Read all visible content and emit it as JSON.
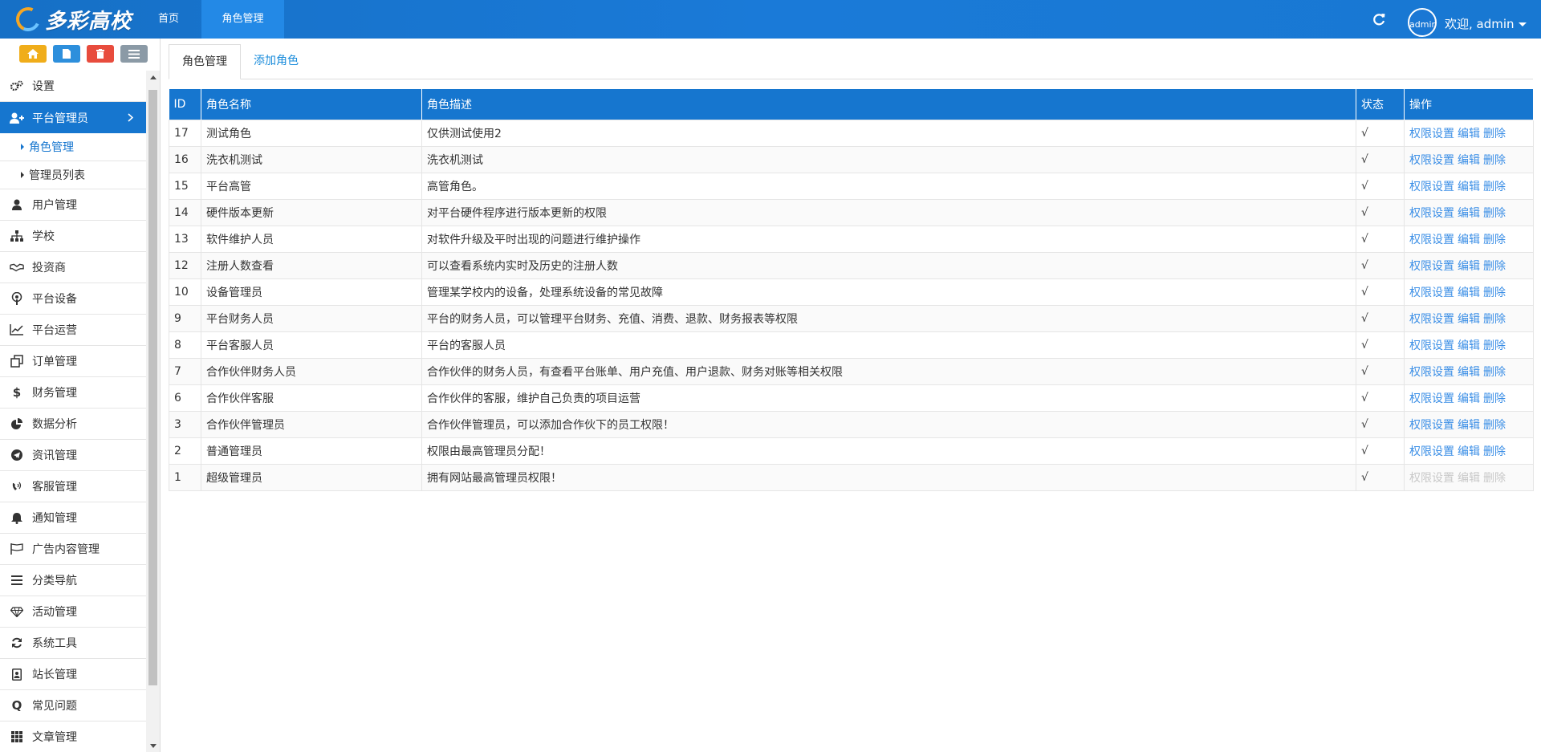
{
  "header": {
    "logo_text": "多彩高校",
    "nav": [
      {
        "label": "首页"
      },
      {
        "label": "角色管理"
      }
    ],
    "avatar_alt": "admin",
    "welcome": "欢迎, admin"
  },
  "sidebar": {
    "items": [
      {
        "label": "设置",
        "icon": "gears-icon"
      },
      {
        "label": "平台管理员",
        "icon": "user-plus-icon"
      },
      {
        "label": "用户管理",
        "icon": "user-icon"
      },
      {
        "label": "学校",
        "icon": "sitemap-icon"
      },
      {
        "label": "投资商",
        "icon": "handshake-icon"
      },
      {
        "label": "平台设备",
        "icon": "podcast-icon"
      },
      {
        "label": "平台运营",
        "icon": "line-chart-icon"
      },
      {
        "label": "订单管理",
        "icon": "clone-icon"
      },
      {
        "label": "财务管理",
        "icon": "dollar-icon"
      },
      {
        "label": "数据分析",
        "icon": "pie-chart-icon"
      },
      {
        "label": "资讯管理",
        "icon": "telegram-icon"
      },
      {
        "label": "客服管理",
        "icon": "volume-control-phone-icon"
      },
      {
        "label": "通知管理",
        "icon": "bell-icon"
      },
      {
        "label": "广告内容管理",
        "icon": "flag-icon"
      },
      {
        "label": "分类导航",
        "icon": "bars-icon"
      },
      {
        "label": "活动管理",
        "icon": "diamond-icon"
      },
      {
        "label": "系统工具",
        "icon": "refresh-icon"
      },
      {
        "label": "站长管理",
        "icon": "id-badge-icon"
      },
      {
        "label": "常见问题",
        "icon": "quora-icon"
      },
      {
        "label": "文章管理",
        "icon": "th-icon"
      }
    ],
    "sub_items": [
      {
        "label": "角色管理"
      },
      {
        "label": "管理员列表"
      }
    ]
  },
  "main": {
    "tabs": [
      {
        "label": "角色管理"
      },
      {
        "label": "添加角色"
      }
    ],
    "table": {
      "headers": [
        "ID",
        "角色名称",
        "角色描述",
        "状态",
        "操作"
      ],
      "rows": [
        {
          "id": "17",
          "name": "测试角色",
          "desc": "仅供测试使用2",
          "status": "√"
        },
        {
          "id": "16",
          "name": "洗衣机测试",
          "desc": "洗衣机测试",
          "status": "√"
        },
        {
          "id": "15",
          "name": "平台高管",
          "desc": "高管角色。",
          "status": "√"
        },
        {
          "id": "14",
          "name": "硬件版本更新",
          "desc": "对平台硬件程序进行版本更新的权限",
          "status": "√"
        },
        {
          "id": "13",
          "name": "软件维护人员",
          "desc": "对软件升级及平时出现的问题进行维护操作",
          "status": "√"
        },
        {
          "id": "12",
          "name": "注册人数查看",
          "desc": "可以查看系统内实时及历史的注册人数",
          "status": "√"
        },
        {
          "id": "10",
          "name": "设备管理员",
          "desc": "管理某学校内的设备，处理系统设备的常见故障",
          "status": "√"
        },
        {
          "id": "9",
          "name": "平台财务人员",
          "desc": "平台的财务人员，可以管理平台财务、充值、消费、退款、财务报表等权限",
          "status": "√"
        },
        {
          "id": "8",
          "name": "平台客服人员",
          "desc": "平台的客服人员",
          "status": "√"
        },
        {
          "id": "7",
          "name": "合作伙伴财务人员",
          "desc": "合作伙伴的财务人员，有查看平台账单、用户充值、用户退款、财务对账等相关权限",
          "status": "√"
        },
        {
          "id": "6",
          "name": "合作伙伴客服",
          "desc": "合作伙伴的客服，维护自己负责的项目运营",
          "status": "√"
        },
        {
          "id": "3",
          "name": "合作伙伴管理员",
          "desc": "合作伙伴管理员，可以添加合作伙下的员工权限！",
          "status": "√"
        },
        {
          "id": "2",
          "name": "普通管理员",
          "desc": "权限由最高管理员分配！",
          "status": "√"
        },
        {
          "id": "1",
          "name": "超级管理员",
          "desc": "拥有网站最高管理员权限！",
          "status": "√"
        }
      ],
      "actions": {
        "perm": "权限设置",
        "edit": "编辑",
        "del": "删除"
      }
    }
  },
  "colors": {
    "primary": "#1676cf",
    "link": "#3a8ee6",
    "status": "#e8362b"
  }
}
